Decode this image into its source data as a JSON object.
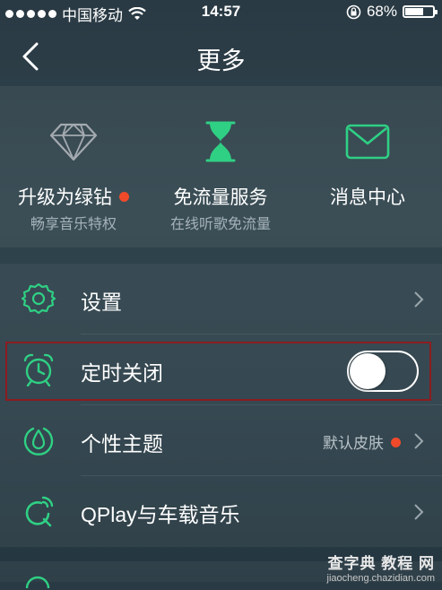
{
  "status_bar": {
    "carrier": "中国移动",
    "time": "14:57",
    "battery_percent": "68%",
    "battery_level": 0.68,
    "icons": [
      "signal-dots-icon",
      "wifi-icon",
      "rotation-lock-icon",
      "battery-icon"
    ]
  },
  "nav": {
    "title": "更多",
    "back_icon": "chevron-left-icon"
  },
  "features": [
    {
      "label": "升级为绿钻",
      "sublabel": "畅享音乐特权",
      "icon": "diamond-icon",
      "has_badge": true
    },
    {
      "label": "免流量服务",
      "sublabel": "在线听歌免流量",
      "icon": "hourglass-icon",
      "has_badge": false
    },
    {
      "label": "消息中心",
      "sublabel": "",
      "icon": "envelope-icon",
      "has_badge": false
    }
  ],
  "list": [
    {
      "label": "设置",
      "icon": "gear-icon",
      "type": "link"
    },
    {
      "label": "定时关闭",
      "icon": "alarm-clock-icon",
      "type": "toggle",
      "toggle_on": false
    },
    {
      "label": "个性主题",
      "icon": "theme-icon",
      "type": "link",
      "value": "默认皮肤",
      "has_badge": true
    },
    {
      "label": "QPlay与车载音乐",
      "icon": "qplay-icon",
      "type": "link"
    }
  ],
  "watermark": {
    "line1": "查字典 教程 网",
    "line2": "jiaocheng.chazidian.com"
  },
  "colors": {
    "accent_green": "#2fd084",
    "badge_red": "#f04a2b",
    "highlight_border": "#8b1c20"
  }
}
